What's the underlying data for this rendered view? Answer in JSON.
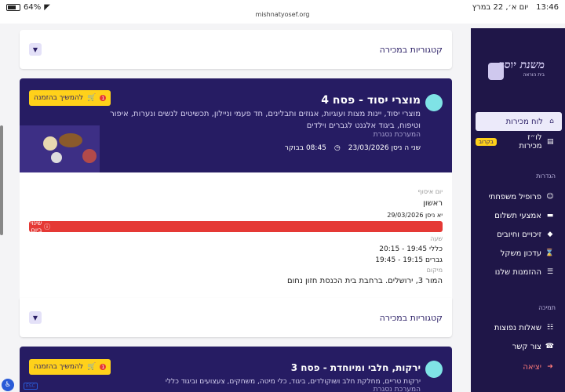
{
  "status": {
    "time": "13:46",
    "date": "יום א׳, 22 במרץ",
    "battery": "64%"
  },
  "url": "mishnatyosef.org",
  "sidebar": {
    "logo_title": "משנת יוסף",
    "logo_sub": "בית הוראה",
    "active_item": "לוח מכירות",
    "calendar_item": "לו״ז מכירות",
    "new_badge": "בקרוב",
    "settings_section": "הגדרות",
    "items": [
      "פרופיל משפחתי",
      "אמצעי תשלום",
      "זיכויים וחיובים",
      "עדכון משקל",
      "ההזמנות שלנו"
    ],
    "support_section": "תמיכה",
    "support_items": [
      "שאלות נפוצות",
      "צור קשר"
    ],
    "logout": "יציאה"
  },
  "categories_label": "קטגוריות במכירה",
  "sale1": {
    "title": "מוצרי יסוד - פסח 4",
    "desc": "מוצרי יסוד, יינות מצות ועוגיות, אגוזים ותבלינים, חד פעמי וניילון, תכשיטים לנשים ונערות, איפור וטיפוח, ביגוד אלגנט לגברים וילדים",
    "system": "המערכת נסגרת",
    "date": "שני ה ניסן 23/03/2026",
    "time": "08:45 בבוקר",
    "cta": "להמשיך בהזמנה",
    "cart_count": "1"
  },
  "details": {
    "day_label": "יום איסוף",
    "day_value": "ראשון",
    "date_value": "יא ניסן 29/03/2026",
    "alert": "שינוי ביום",
    "hour_label": "שעה",
    "hour_general": "כללי 19:45 - 20:15",
    "hour_men": "גברים 19:15 - 19:45",
    "place_label": "מיקום",
    "place_value": "המור 3, ירושלים. ברחבת בית הכנסת חזון נחום"
  },
  "sale2": {
    "title": "ירקות, חלבי ומיוחדת - פסח 3",
    "desc": "ירקות טריים, מחלקת חלב ושוקולדים, ביגוד, כלי מיטה, משחקים, צעצועים וביגוד כללי",
    "system": "המערכת נסגרת",
    "cta": "להמשיך בהזמנה",
    "cart_count": "1"
  },
  "accessibility_label": "ESC"
}
